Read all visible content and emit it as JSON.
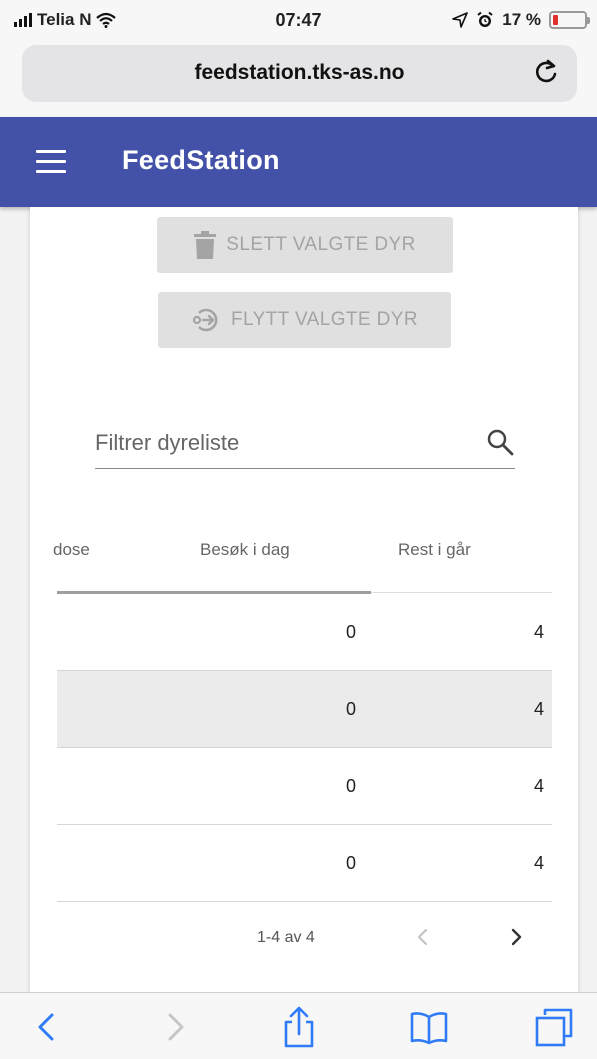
{
  "status_bar": {
    "carrier": "Telia N",
    "time": "07:47",
    "battery": "17 %",
    "battery_level": 0.17,
    "battery_color": "#e0302b"
  },
  "browser": {
    "url": "feedstation.tks-as.no",
    "reload_icon": "reload-icon"
  },
  "app_bar": {
    "title": "FeedStation",
    "color": "#4352a8",
    "menu_icon": "hamburger-menu-icon"
  },
  "actions": {
    "delete_label": "SLETT VALGTE DYR",
    "delete_icon": "trash-icon",
    "move_label": "FLYTT VALGTE DYR",
    "move_icon": "move-arrow-icon"
  },
  "filter": {
    "placeholder": "Filtrer dyreliste",
    "value": "",
    "icon": "search-icon"
  },
  "table": {
    "columns": {
      "dose": "dose",
      "besok": "Besøk i dag",
      "rest": "Rest i går"
    },
    "rows": [
      {
        "besok": "0",
        "rest": "4",
        "highlighted": false
      },
      {
        "besok": "0",
        "rest": "4",
        "highlighted": true
      },
      {
        "besok": "0",
        "rest": "4",
        "highlighted": false
      },
      {
        "besok": "0",
        "rest": "4",
        "highlighted": false
      }
    ]
  },
  "paginator": {
    "range_label": "1-4 av 4",
    "prev_icon": "chevron-left-icon",
    "next_icon": "chevron-right-icon"
  },
  "toolbar": {
    "icons": [
      "back-icon",
      "forward-icon",
      "share-icon",
      "bookmarks-icon",
      "tabs-icon"
    ]
  }
}
